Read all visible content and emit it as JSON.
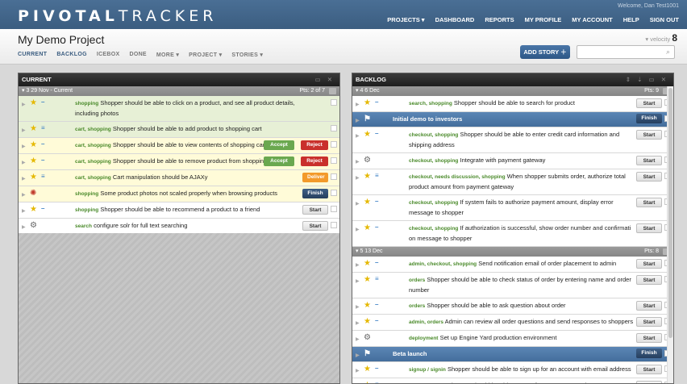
{
  "topbar": {
    "logo_bold": "PIVOTAL",
    "logo_rest": "TRACKER",
    "welcome": "Welcome, Dan Test1001",
    "nav": [
      "PROJECTS ▾",
      "DASHBOARD",
      "REPORTS",
      "MY PROFILE",
      "MY ACCOUNT",
      "HELP",
      "SIGN OUT"
    ]
  },
  "header": {
    "project_title": "My Demo Project",
    "tabs": [
      "CURRENT",
      "BACKLOG",
      "ICEBOX",
      "DONE",
      "MORE ▾",
      "PROJECT ▾",
      "STORIES ▾"
    ],
    "velocity_label": "▾ velocity",
    "velocity_value": "8",
    "add_story": "ADD STORY ＋",
    "search_icon": "search-icon"
  },
  "current": {
    "title": "CURRENT",
    "iteration": {
      "label": "▾ 3   29 Nov - Current",
      "pts": "Pts: 2 of 7"
    },
    "stories": [
      {
        "labels": "shopping",
        "text": "Shopper should be able to click on a product, and see all product details, including photos",
        "state": "done",
        "type": "feature"
      },
      {
        "labels": "cart, shopping",
        "text": "Shopper should be able to add product to shopping cart",
        "state": "done",
        "type": "feature"
      },
      {
        "labels": "cart, shopping",
        "text": "Shopper should be able to view contents of shopping cart",
        "state": "progress",
        "type": "feature",
        "btn1": "Accept",
        "btn2": "Reject"
      },
      {
        "labels": "cart, shopping",
        "text": "Shopper should be able to remove product from shopping cart",
        "state": "progress",
        "type": "feature",
        "btn1": "Accept",
        "btn2": "Reject"
      },
      {
        "labels": "cart, shopping",
        "text": "Cart manipulation should be AJAXy",
        "state": "progress",
        "type": "feature",
        "btn": "Deliver"
      },
      {
        "labels": "shopping",
        "text": "Some product photos not scaled properly when browsing products",
        "state": "progress",
        "type": "bug",
        "btn": "Finish"
      },
      {
        "labels": "shopping",
        "text": "Shopper should be able to recommend a product to a friend",
        "state": "",
        "type": "feature",
        "btn": "Start"
      },
      {
        "labels": "search",
        "text": "configure solr for full text searching",
        "state": "",
        "type": "chore",
        "btn": "Start"
      }
    ]
  },
  "backlog": {
    "title": "BACKLOG",
    "iter1": {
      "label": "▾ 4   6 Dec",
      "pts": "Pts: 9"
    },
    "iter1_stories": [
      {
        "labels": "search, shopping",
        "text": "Shopper should be able to search for product",
        "type": "feature",
        "btn": "Start"
      },
      {
        "release": true,
        "text": "Initial demo to investors",
        "btn": "Finish"
      },
      {
        "labels": "checkout, shopping",
        "text": "Shopper should be able to enter credit card information and shipping address",
        "type": "feature",
        "btn": "Start"
      },
      {
        "labels": "checkout, shopping",
        "text": "Integrate with payment gateway",
        "type": "chore",
        "btn": "Start"
      },
      {
        "labels": "checkout, needs discussion, shopping",
        "text": "When shopper submits order, authorize total product amount from payment gateway",
        "type": "feature",
        "btn": "Start"
      },
      {
        "labels": "checkout, shopping",
        "text": "If system fails to authorize payment amount, display error message to shopper",
        "type": "feature",
        "btn": "Start"
      },
      {
        "labels": "checkout, shopping",
        "text": "If authorization is successful, show order number and confirmati on message to shopper",
        "type": "feature",
        "btn": "Start"
      }
    ],
    "iter2": {
      "label": "▾ 5   13 Dec",
      "pts": "Pts: 8"
    },
    "iter2_stories": [
      {
        "labels": "admin, checkout, shopping",
        "text": "Send notification email of order placement to admin",
        "type": "feature",
        "btn": "Start"
      },
      {
        "labels": "orders",
        "text": "Shopper should be able to check status of order by entering name and order number",
        "type": "feature",
        "btn": "Start"
      },
      {
        "labels": "orders",
        "text": "Shopper should be able to ask question about order",
        "type": "feature",
        "btn": "Start"
      },
      {
        "labels": "admin, orders",
        "text": "Admin can review all order questions and send responses to shoppers",
        "type": "feature",
        "btn": "Start"
      },
      {
        "labels": "deployment",
        "text": "Set up Engine Yard production environment",
        "type": "chore",
        "btn": "Start"
      },
      {
        "release": true,
        "text": "Beta launch",
        "btn": "Finish"
      },
      {
        "labels": "signup / signin",
        "text": "Shopper should be able to sign up for an account with email address",
        "type": "feature",
        "btn": "Start"
      },
      {
        "labels": "signup / signin",
        "text": "Shopper should be able to reset forgotten password",
        "type": "feature",
        "btn": "Start"
      }
    ]
  }
}
